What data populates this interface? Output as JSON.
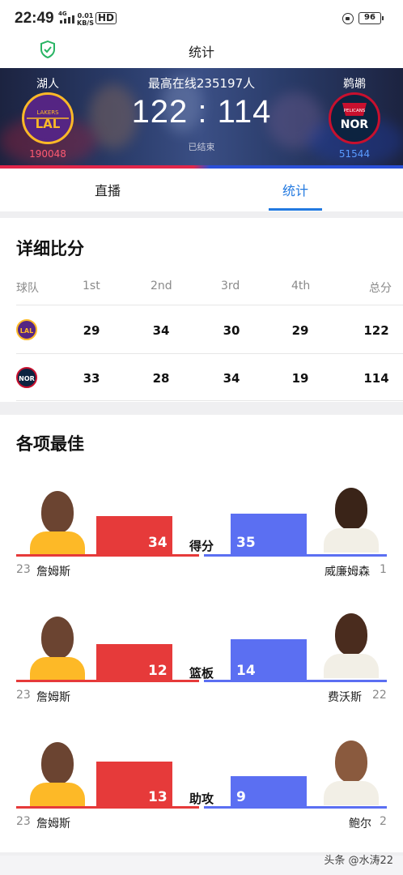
{
  "status_bar": {
    "time": "22:49",
    "network": "4G",
    "speed_value": "0.01",
    "speed_unit": "KB/S",
    "hd": "HD",
    "battery": "96"
  },
  "header": {
    "title": "统计",
    "shield_icon": "shield-check-icon"
  },
  "scoreboard": {
    "online": "最高在线235197人",
    "score": "122 : 114",
    "status": "已结束",
    "home": {
      "name": "湖人",
      "logo_text": "LAL",
      "logo_top": "LAKERS",
      "support": "190048",
      "color": "#552583"
    },
    "away": {
      "name": "鹈鹕",
      "logo_text": "NOR",
      "logo_top": "PELICANS",
      "support": "51544",
      "color": "#0c2340"
    }
  },
  "tabs": [
    {
      "label": "直播",
      "active": false
    },
    {
      "label": "统计",
      "active": true
    }
  ],
  "detail": {
    "title": "详细比分",
    "headers": [
      "球队",
      "1st",
      "2nd",
      "3rd",
      "4th",
      "总分"
    ],
    "rows": [
      {
        "team": "LAL",
        "q1": "29",
        "q2": "34",
        "q3": "30",
        "q4": "29",
        "total": "122"
      },
      {
        "team": "NOR",
        "q1": "33",
        "q2": "28",
        "q3": "34",
        "q4": "19",
        "total": "114"
      }
    ]
  },
  "best": {
    "title": "各项最佳",
    "items": [
      {
        "category": "得分",
        "home_value": "34",
        "away_value": "35",
        "home_player": "詹姆斯",
        "home_number": "23",
        "away_player": "威廉姆森",
        "away_number": "1"
      },
      {
        "category": "篮板",
        "home_value": "12",
        "away_value": "14",
        "home_player": "詹姆斯",
        "home_number": "23",
        "away_player": "费沃斯",
        "away_number": "22"
      },
      {
        "category": "助攻",
        "home_value": "13",
        "away_value": "9",
        "home_player": "詹姆斯",
        "home_number": "23",
        "away_player": "鲍尔",
        "away_number": "2"
      }
    ]
  },
  "watermark": "头条 @水涛22"
}
